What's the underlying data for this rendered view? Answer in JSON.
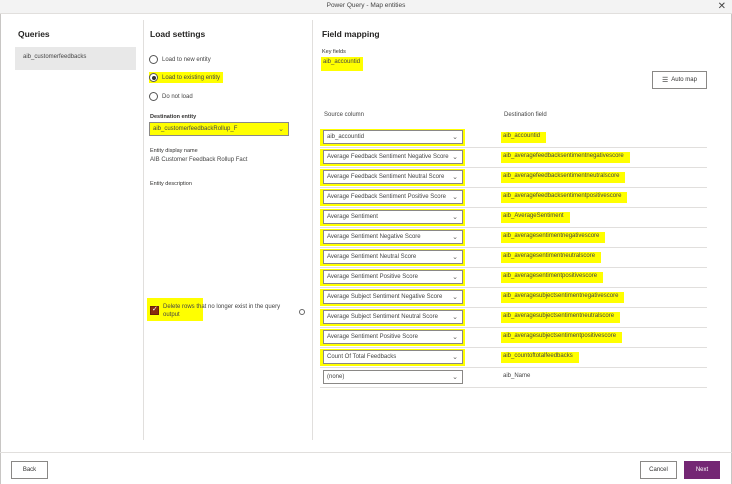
{
  "window": {
    "title": "Power Query - Map entities",
    "close_glyph": "✕"
  },
  "queries": {
    "heading": "Queries",
    "items": [
      "aib_customerfeedbacks"
    ]
  },
  "load_settings": {
    "heading": "Load settings",
    "options": [
      "Load to new entity",
      "Load to existing entity",
      "Do not load"
    ],
    "selected_index": 1,
    "destination_label": "Destination entity",
    "destination_value": "aib_customerfeedbackRollup_F",
    "display_name_label": "Entity display name",
    "display_name_value": "AIB Customer Feedback Rollup Fact",
    "description_label": "Entity description",
    "delete_rows_label": "Delete rows that no longer exist in the query output",
    "delete_rows_checked": true
  },
  "field_mapping": {
    "heading": "Field mapping",
    "key_fields_label": "Key fields",
    "key_fields_value": "aib_accountid",
    "automap_label": "Auto map",
    "source_header": "Source column",
    "dest_header": "Destination field",
    "rows": [
      {
        "source": "aib_accountid",
        "dest": "aib_accountid"
      },
      {
        "source": "Average Feedback Sentiment Negative Score",
        "dest": "aib_averagefeedbacksentimentnegativescore"
      },
      {
        "source": "Average Feedback Sentiment Neutral Score",
        "dest": "aib_averagefeedbacksentimentneutralscore"
      },
      {
        "source": "Average Feedback Sentiment Positive Score",
        "dest": "aib_averagefeedbacksentimentpositivescore"
      },
      {
        "source": "Average Sentiment",
        "dest": "aib_AverageSentiment"
      },
      {
        "source": "Average Sentiment Negative Score",
        "dest": "aib_averagesentimentnegativescore"
      },
      {
        "source": "Average Sentiment Neutral Score",
        "dest": "aib_averagesentimentneutralscore"
      },
      {
        "source": "Average Sentiment Positive Score",
        "dest": "aib_averagesentimentpositivescore"
      },
      {
        "source": "Average Subject Sentiment Negative Score",
        "dest": "aib_averagesubjectsentimentnegativescore"
      },
      {
        "source": "Average Subject Sentiment Neutral Score",
        "dest": "aib_averagesubjectsentimentneutralscore"
      },
      {
        "source": "Average Sentiment Positive Score",
        "dest": "aib_averagesubjectsentimentpositivescore"
      },
      {
        "source": "Count Of Total Feedbacks",
        "dest": "aib_countoftotalfeedbacks"
      },
      {
        "source": "(none)",
        "dest": "aib_Name"
      }
    ]
  },
  "footer": {
    "back_label": "Back",
    "cancel_label": "Cancel",
    "next_label": "Next"
  },
  "colors": {
    "highlight": "#ffff00",
    "primary": "#742774",
    "checkbox": "#8a2b0e"
  }
}
